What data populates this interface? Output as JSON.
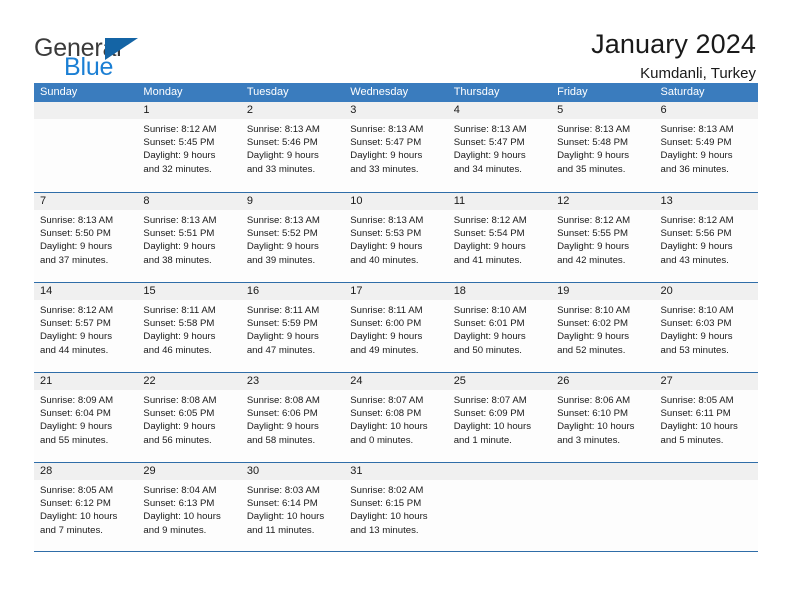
{
  "brand": {
    "name_part1": "General",
    "name_part2": "Blue",
    "accent_color": "#1b7fd4",
    "triangle_color": "#1464a5"
  },
  "header": {
    "title": "January 2024",
    "subtitle": "Kumdanli, Turkey"
  },
  "calendar": {
    "header_bg": "#3a7cbe",
    "day_band_bg": "#f0f0f0",
    "grid_line_color": "#2f6da8",
    "weekdays": [
      "Sunday",
      "Monday",
      "Tuesday",
      "Wednesday",
      "Thursday",
      "Friday",
      "Saturday"
    ],
    "weeks": [
      [
        {
          "day": "",
          "l1": "",
          "l2": "",
          "l3": "",
          "l4": ""
        },
        {
          "day": "1",
          "l1": "Sunrise: 8:12 AM",
          "l2": "Sunset: 5:45 PM",
          "l3": "Daylight: 9 hours",
          "l4": "and 32 minutes."
        },
        {
          "day": "2",
          "l1": "Sunrise: 8:13 AM",
          "l2": "Sunset: 5:46 PM",
          "l3": "Daylight: 9 hours",
          "l4": "and 33 minutes."
        },
        {
          "day": "3",
          "l1": "Sunrise: 8:13 AM",
          "l2": "Sunset: 5:47 PM",
          "l3": "Daylight: 9 hours",
          "l4": "and 33 minutes."
        },
        {
          "day": "4",
          "l1": "Sunrise: 8:13 AM",
          "l2": "Sunset: 5:47 PM",
          "l3": "Daylight: 9 hours",
          "l4": "and 34 minutes."
        },
        {
          "day": "5",
          "l1": "Sunrise: 8:13 AM",
          "l2": "Sunset: 5:48 PM",
          "l3": "Daylight: 9 hours",
          "l4": "and 35 minutes."
        },
        {
          "day": "6",
          "l1": "Sunrise: 8:13 AM",
          "l2": "Sunset: 5:49 PM",
          "l3": "Daylight: 9 hours",
          "l4": "and 36 minutes."
        }
      ],
      [
        {
          "day": "7",
          "l1": "Sunrise: 8:13 AM",
          "l2": "Sunset: 5:50 PM",
          "l3": "Daylight: 9 hours",
          "l4": "and 37 minutes."
        },
        {
          "day": "8",
          "l1": "Sunrise: 8:13 AM",
          "l2": "Sunset: 5:51 PM",
          "l3": "Daylight: 9 hours",
          "l4": "and 38 minutes."
        },
        {
          "day": "9",
          "l1": "Sunrise: 8:13 AM",
          "l2": "Sunset: 5:52 PM",
          "l3": "Daylight: 9 hours",
          "l4": "and 39 minutes."
        },
        {
          "day": "10",
          "l1": "Sunrise: 8:13 AM",
          "l2": "Sunset: 5:53 PM",
          "l3": "Daylight: 9 hours",
          "l4": "and 40 minutes."
        },
        {
          "day": "11",
          "l1": "Sunrise: 8:12 AM",
          "l2": "Sunset: 5:54 PM",
          "l3": "Daylight: 9 hours",
          "l4": "and 41 minutes."
        },
        {
          "day": "12",
          "l1": "Sunrise: 8:12 AM",
          "l2": "Sunset: 5:55 PM",
          "l3": "Daylight: 9 hours",
          "l4": "and 42 minutes."
        },
        {
          "day": "13",
          "l1": "Sunrise: 8:12 AM",
          "l2": "Sunset: 5:56 PM",
          "l3": "Daylight: 9 hours",
          "l4": "and 43 minutes."
        }
      ],
      [
        {
          "day": "14",
          "l1": "Sunrise: 8:12 AM",
          "l2": "Sunset: 5:57 PM",
          "l3": "Daylight: 9 hours",
          "l4": "and 44 minutes."
        },
        {
          "day": "15",
          "l1": "Sunrise: 8:11 AM",
          "l2": "Sunset: 5:58 PM",
          "l3": "Daylight: 9 hours",
          "l4": "and 46 minutes."
        },
        {
          "day": "16",
          "l1": "Sunrise: 8:11 AM",
          "l2": "Sunset: 5:59 PM",
          "l3": "Daylight: 9 hours",
          "l4": "and 47 minutes."
        },
        {
          "day": "17",
          "l1": "Sunrise: 8:11 AM",
          "l2": "Sunset: 6:00 PM",
          "l3": "Daylight: 9 hours",
          "l4": "and 49 minutes."
        },
        {
          "day": "18",
          "l1": "Sunrise: 8:10 AM",
          "l2": "Sunset: 6:01 PM",
          "l3": "Daylight: 9 hours",
          "l4": "and 50 minutes."
        },
        {
          "day": "19",
          "l1": "Sunrise: 8:10 AM",
          "l2": "Sunset: 6:02 PM",
          "l3": "Daylight: 9 hours",
          "l4": "and 52 minutes."
        },
        {
          "day": "20",
          "l1": "Sunrise: 8:10 AM",
          "l2": "Sunset: 6:03 PM",
          "l3": "Daylight: 9 hours",
          "l4": "and 53 minutes."
        }
      ],
      [
        {
          "day": "21",
          "l1": "Sunrise: 8:09 AM",
          "l2": "Sunset: 6:04 PM",
          "l3": "Daylight: 9 hours",
          "l4": "and 55 minutes."
        },
        {
          "day": "22",
          "l1": "Sunrise: 8:08 AM",
          "l2": "Sunset: 6:05 PM",
          "l3": "Daylight: 9 hours",
          "l4": "and 56 minutes."
        },
        {
          "day": "23",
          "l1": "Sunrise: 8:08 AM",
          "l2": "Sunset: 6:06 PM",
          "l3": "Daylight: 9 hours",
          "l4": "and 58 minutes."
        },
        {
          "day": "24",
          "l1": "Sunrise: 8:07 AM",
          "l2": "Sunset: 6:08 PM",
          "l3": "Daylight: 10 hours",
          "l4": "and 0 minutes."
        },
        {
          "day": "25",
          "l1": "Sunrise: 8:07 AM",
          "l2": "Sunset: 6:09 PM",
          "l3": "Daylight: 10 hours",
          "l4": "and 1 minute."
        },
        {
          "day": "26",
          "l1": "Sunrise: 8:06 AM",
          "l2": "Sunset: 6:10 PM",
          "l3": "Daylight: 10 hours",
          "l4": "and 3 minutes."
        },
        {
          "day": "27",
          "l1": "Sunrise: 8:05 AM",
          "l2": "Sunset: 6:11 PM",
          "l3": "Daylight: 10 hours",
          "l4": "and 5 minutes."
        }
      ],
      [
        {
          "day": "28",
          "l1": "Sunrise: 8:05 AM",
          "l2": "Sunset: 6:12 PM",
          "l3": "Daylight: 10 hours",
          "l4": "and 7 minutes."
        },
        {
          "day": "29",
          "l1": "Sunrise: 8:04 AM",
          "l2": "Sunset: 6:13 PM",
          "l3": "Daylight: 10 hours",
          "l4": "and 9 minutes."
        },
        {
          "day": "30",
          "l1": "Sunrise: 8:03 AM",
          "l2": "Sunset: 6:14 PM",
          "l3": "Daylight: 10 hours",
          "l4": "and 11 minutes."
        },
        {
          "day": "31",
          "l1": "Sunrise: 8:02 AM",
          "l2": "Sunset: 6:15 PM",
          "l3": "Daylight: 10 hours",
          "l4": "and 13 minutes."
        },
        {
          "day": "",
          "l1": "",
          "l2": "",
          "l3": "",
          "l4": ""
        },
        {
          "day": "",
          "l1": "",
          "l2": "",
          "l3": "",
          "l4": ""
        },
        {
          "day": "",
          "l1": "",
          "l2": "",
          "l3": "",
          "l4": ""
        }
      ]
    ]
  }
}
